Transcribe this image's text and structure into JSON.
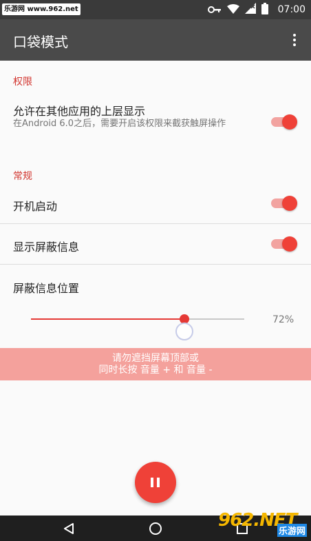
{
  "status_bar": {
    "watermark_badge": "乐游网 www.962.net",
    "time": "07:00",
    "icons": [
      "key-icon",
      "wifi-icon",
      "signal-icon",
      "battery-icon"
    ]
  },
  "app_bar": {
    "title": "口袋模式",
    "overflow_icon": "more-vert-icon"
  },
  "sections": {
    "permissions": {
      "header": "权限",
      "overlay": {
        "title": "允许在其他应用的上层显示",
        "subtitle": "在Android 6.0之后，需要开启该权限来截获触屏操作",
        "enabled": true
      }
    },
    "general": {
      "header": "常规",
      "start_on_boot": {
        "title": "开机启动",
        "enabled": true
      },
      "show_mask_info": {
        "title": "显示屏蔽信息",
        "enabled": true
      },
      "mask_position": {
        "title": "屏蔽信息位置",
        "value_label": "72%",
        "value": 0.72
      }
    }
  },
  "banner": {
    "line1": "请勿遮挡屏幕顶部或",
    "line2": "同时长按 音量 + 和 音量 -"
  },
  "fab": {
    "icon": "pause-icon"
  },
  "nav_bar": {
    "icons": [
      "back-icon",
      "home-icon",
      "recents-icon"
    ]
  },
  "watermark": {
    "big": "962.NET",
    "small": "乐游网"
  },
  "colors": {
    "accent": "#ef4138",
    "app_bar": "#4a4a4a",
    "status_bar": "#3a3a3a",
    "banner": "#f4a19c"
  }
}
